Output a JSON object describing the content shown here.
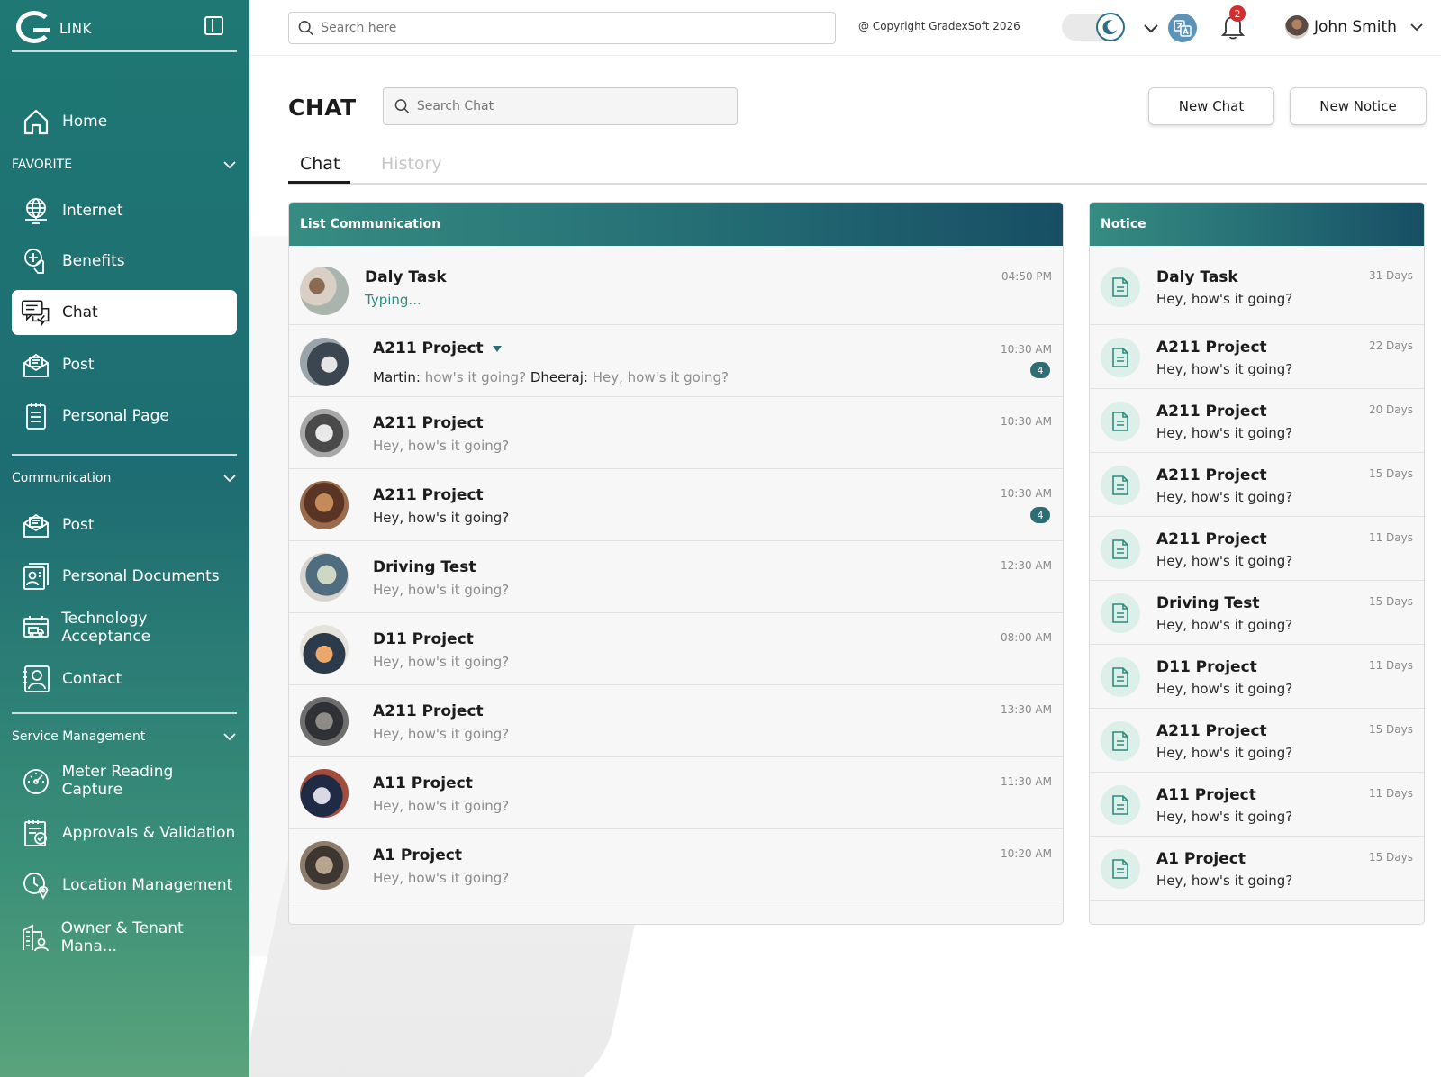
{
  "brand": {
    "name": "LINK"
  },
  "sidebar": {
    "home": "Home",
    "favorite_label": "FAVORITE",
    "favorites": [
      {
        "label": "Internet",
        "icon": "globe-monitor-icon"
      },
      {
        "label": "Benefits",
        "icon": "benefits-hand-icon"
      },
      {
        "label": "Chat",
        "icon": "chat-bubbles-icon",
        "active": true
      },
      {
        "label": "Post",
        "icon": "post-envelope-icon"
      },
      {
        "label": "Personal Page",
        "icon": "clipboard-icon"
      }
    ],
    "communication_label": "Communication",
    "communication": [
      {
        "label": "Post",
        "icon": "post-envelope-icon"
      },
      {
        "label": "Personal Documents",
        "icon": "personal-documents-icon"
      },
      {
        "label": "Technology Acceptance",
        "icon": "calendar-truck-icon"
      },
      {
        "label": "Contact",
        "icon": "contact-card-icon"
      }
    ],
    "service_label": "Service Management",
    "service": [
      {
        "label": "Meter Reading Capture",
        "icon": "gauge-icon"
      },
      {
        "label": "Approvals & Validation",
        "icon": "approvals-icon"
      },
      {
        "label": "Location Management",
        "icon": "location-clock-icon"
      },
      {
        "label": "Owner & Tenant Mana...",
        "icon": "building-person-icon"
      }
    ]
  },
  "topbar": {
    "search_placeholder": "Search here",
    "copyright": "@ Copyright GradexSoft 2026",
    "notification_count": "2",
    "user_name": "John Smith"
  },
  "page": {
    "title": "CHAT",
    "search_placeholder": "Search Chat",
    "new_chat": "New Chat",
    "new_notice": "New Notice",
    "tabs": [
      "Chat",
      "History"
    ]
  },
  "list": {
    "header": "List Communication",
    "rows": [
      {
        "name": "Daly Task",
        "message": "Typing...",
        "time": "04:50 PM"
      },
      {
        "name": "A211 Project",
        "sender1": "Martin:",
        "msg1": "how's it going?",
        "sender2": "Dheeraj:",
        "msg2": "Hey, how's it going?",
        "time": "10:30 AM",
        "count": "4"
      },
      {
        "name": "A211 Project",
        "message": "Hey, how's it going?",
        "time": "10:30 AM"
      },
      {
        "name": "A211 Project",
        "message": "Hey, how's it going?",
        "time": "10:30 AM",
        "count": "4"
      },
      {
        "name": "Driving Test",
        "message": "Hey, how's it going?",
        "time": "12:30 AM"
      },
      {
        "name": "D11 Project",
        "message": "Hey, how's it going?",
        "time": "08:00 AM"
      },
      {
        "name": "A211 Project",
        "message": "Hey, how's it going?",
        "time": "13:30 AM"
      },
      {
        "name": "A11 Project",
        "message": "Hey, how's it going?",
        "time": "11:30 AM"
      },
      {
        "name": "A1 Project",
        "message": "Hey, how's it going?",
        "time": "10:20 AM"
      }
    ]
  },
  "notice": {
    "header": "Notice",
    "rows": [
      {
        "name": "Daly Task",
        "message": "Hey, how's it going?",
        "days": "31 Days"
      },
      {
        "name": "A211 Project",
        "message": "Hey, how's it going?",
        "days": "22 Days"
      },
      {
        "name": "A211 Project",
        "message": "Hey, how's it going?",
        "days": "20 Days"
      },
      {
        "name": "A211 Project",
        "message": "Hey, how's it going?",
        "days": "15 Days"
      },
      {
        "name": "A211 Project",
        "message": "Hey, how's it going?",
        "days": "11 Days"
      },
      {
        "name": "Driving Test",
        "message": "Hey, how's it going?",
        "days": "15 Days"
      },
      {
        "name": "D11 Project",
        "message": "Hey, how's it going?",
        "days": "11 Days"
      },
      {
        "name": "A211 Project",
        "message": "Hey, how's it going?",
        "days": "15 Days"
      },
      {
        "name": "A11 Project",
        "message": "Hey, how's it going?",
        "days": "11 Days"
      },
      {
        "name": "A1 Project",
        "message": "Hey, how's it going?",
        "days": "15 Days"
      }
    ]
  },
  "colors": {
    "sidebar_top": "#1f7873",
    "sidebar_bottom": "#5aa37c",
    "panel_header": "#246d74",
    "badge": "#2e6e73",
    "notification_badge": "#d32d2d"
  }
}
